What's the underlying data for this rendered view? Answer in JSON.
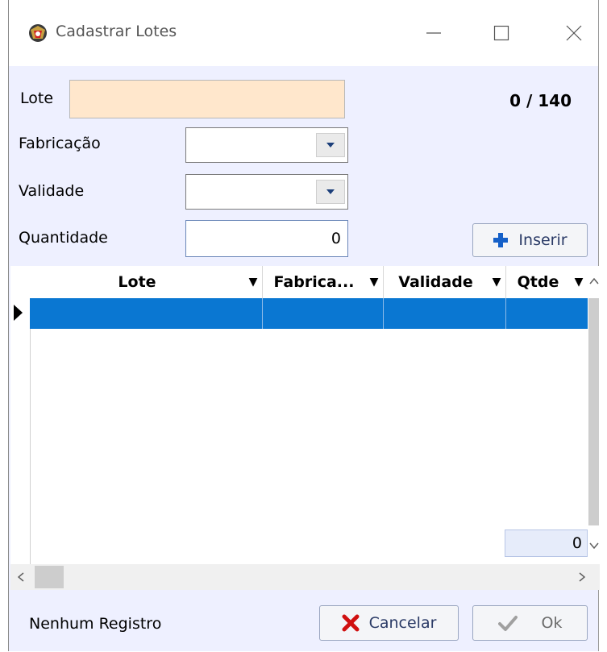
{
  "window": {
    "title": "Cadastrar Lotes",
    "icons": {
      "app": "app-logo-icon",
      "minimize": "minimize-icon",
      "maximize": "maximize-icon",
      "close": "close-icon"
    }
  },
  "form": {
    "lote_label": "Lote",
    "lote_value": "",
    "counter": "0 / 140",
    "fabricacao_label": "Fabricação",
    "fabricacao_value": "",
    "validade_label": "Validade",
    "validade_value": "",
    "quantidade_label": "Quantidade",
    "quantidade_value": "0",
    "inserir_label": "Inserir"
  },
  "grid": {
    "columns": [
      {
        "label": "Lote"
      },
      {
        "label": "Fabrica..."
      },
      {
        "label": "Validade"
      },
      {
        "label": "Qtde"
      }
    ],
    "rows": [
      {
        "lote": "",
        "fabricacao": "",
        "validade": "",
        "qtde": ""
      }
    ],
    "footer_total": "0",
    "selected_row_color": "#0a77d2"
  },
  "footer": {
    "status": "Nenhum Registro",
    "cancelar_label": "Cancelar",
    "ok_label": "Ok"
  },
  "colors": {
    "window_bg": "#eef0ff",
    "lote_field_bg": "#ffe7cc",
    "cancel_icon": "#d01010",
    "inserir_icon": "#1560c8"
  }
}
